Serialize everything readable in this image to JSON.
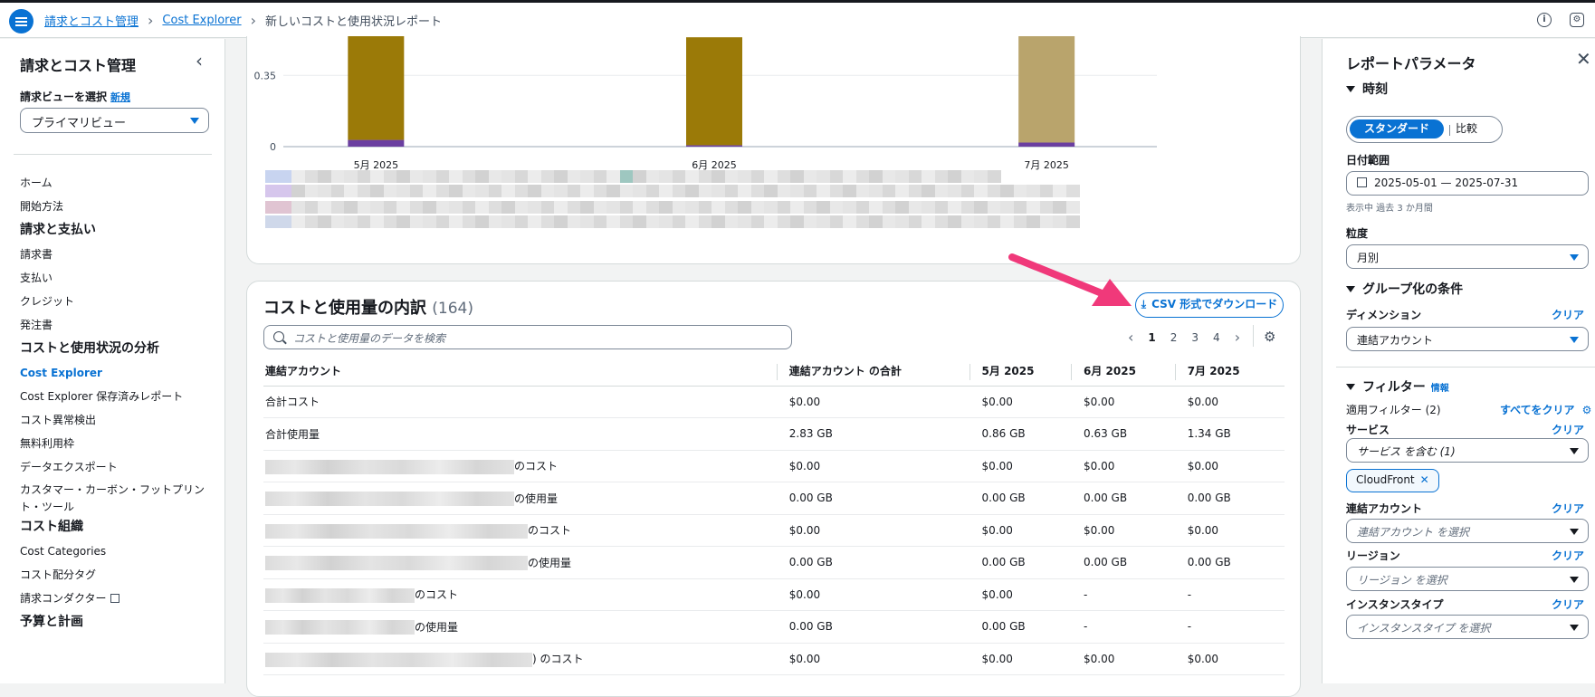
{
  "breadcrumb": {
    "items": [
      "請求とコスト管理",
      "Cost Explorer"
    ],
    "current": "新しいコストと使用状況レポート"
  },
  "sidebar": {
    "title": "請求とコスト管理",
    "view_label": "請求ビューを選択",
    "view_new": "新規",
    "view_select": "プライマリビュー",
    "nav": [
      {
        "type": "item",
        "label": "ホーム"
      },
      {
        "type": "item",
        "label": "開始方法"
      },
      {
        "type": "section",
        "label": "請求と支払い"
      },
      {
        "type": "item",
        "label": "請求書"
      },
      {
        "type": "item",
        "label": "支払い"
      },
      {
        "type": "item",
        "label": "クレジット"
      },
      {
        "type": "item",
        "label": "発注書"
      },
      {
        "type": "section",
        "label": "コストと使用状況の分析"
      },
      {
        "type": "active",
        "label": "Cost Explorer"
      },
      {
        "type": "item",
        "label": "Cost Explorer 保存済みレポート"
      },
      {
        "type": "item",
        "label": "コスト異常検出"
      },
      {
        "type": "item",
        "label": "無料利用枠"
      },
      {
        "type": "item",
        "label": "データエクスポート"
      },
      {
        "type": "two",
        "label": "カスタマー・カーボン・フットプリント・ツール"
      },
      {
        "type": "section",
        "label": "コスト組織"
      },
      {
        "type": "item",
        "label": "Cost Categories"
      },
      {
        "type": "item",
        "label": "コスト配分タグ"
      },
      {
        "type": "ext",
        "label": "請求コンダクター"
      },
      {
        "type": "section",
        "label": "予算と計画"
      }
    ]
  },
  "chart_data": {
    "type": "bar",
    "categories": [
      "5月 2025",
      "6月 2025",
      "7月 2025"
    ],
    "ytick_labels": [
      "0",
      "0.35"
    ],
    "series": [
      {
        "values": [
          0.033,
          0.007,
          0.02
        ]
      },
      {
        "values": [
          0.53,
          0.53,
          0.53
        ]
      }
    ],
    "colors": [
      "#6b3fa0",
      "#9b7a08",
      "#b9a46c"
    ],
    "ylim": [
      0,
      0.56
    ]
  },
  "table": {
    "title": "コストと使用量の内訳",
    "count": "(164)",
    "csv_button": "CSV 形式でダウンロード",
    "search_placeholder": "コストと使用量のデータを検索",
    "pages": [
      "1",
      "2",
      "3",
      "4"
    ],
    "columns": [
      "連結アカウント",
      "連結アカウント の合計",
      "5月 2025",
      "6月 2025",
      "7月 2025"
    ],
    "rows": [
      {
        "name": "合計コスト",
        "blur": 0,
        "cells": [
          "$0.00",
          "$0.00",
          "$0.00",
          "$0.00"
        ]
      },
      {
        "name": "合計使用量",
        "blur": 0,
        "cells": [
          "2.83 GB",
          "0.86 GB",
          "0.63 GB",
          "1.34 GB"
        ]
      },
      {
        "name": "のコスト",
        "blur": 275,
        "cells": [
          "$0.00",
          "$0.00",
          "$0.00",
          "$0.00"
        ]
      },
      {
        "name": "の使用量",
        "blur": 275,
        "cells": [
          "0.00 GB",
          "0.00 GB",
          "0.00 GB",
          "0.00 GB"
        ]
      },
      {
        "name": "のコスト",
        "blur": 290,
        "cells": [
          "$0.00",
          "$0.00",
          "$0.00",
          "$0.00"
        ]
      },
      {
        "name": "の使用量",
        "blur": 290,
        "cells": [
          "0.00 GB",
          "0.00 GB",
          "0.00 GB",
          "0.00 GB"
        ]
      },
      {
        "name": "のコスト",
        "blur": 165,
        "cells": [
          "$0.00",
          "$0.00",
          "-",
          "-"
        ]
      },
      {
        "name": "の使用量",
        "blur": 165,
        "cells": [
          "0.00 GB",
          "0.00 GB",
          "-",
          "-"
        ]
      },
      {
        "name": ") のコスト",
        "blur": 295,
        "cells": [
          "$0.00",
          "$0.00",
          "$0.00",
          "$0.00"
        ]
      }
    ]
  },
  "rpanel": {
    "title": "レポートパラメータ",
    "time_section": "時刻",
    "seg_standard": "スタンダード",
    "seg_compare": "比較",
    "date_label": "日付範囲",
    "date_value": "2025-05-01 — 2025-07-31",
    "date_hint": "表示中 過去 3 か月間",
    "granularity_label": "粒度",
    "granularity_value": "月別",
    "group_section": "グループ化の条件",
    "dimension_label": "ディメンション",
    "clear": "クリア",
    "dimension_value": "連結アカウント",
    "filter_section": "フィルター",
    "info": "情報",
    "applied_filters": "適用フィルター (2)",
    "clear_all": "すべてをクリア",
    "service_label": "サービス",
    "service_value": "サービス を含む (1)",
    "token": "CloudFront",
    "account_label": "連結アカウント",
    "account_ph": "連結アカウント を選択",
    "region_label": "リージョン",
    "region_ph": "リージョン を選択",
    "instance_label": "インスタンスタイプ",
    "instance_ph": "インスタンスタイプ を選択"
  }
}
